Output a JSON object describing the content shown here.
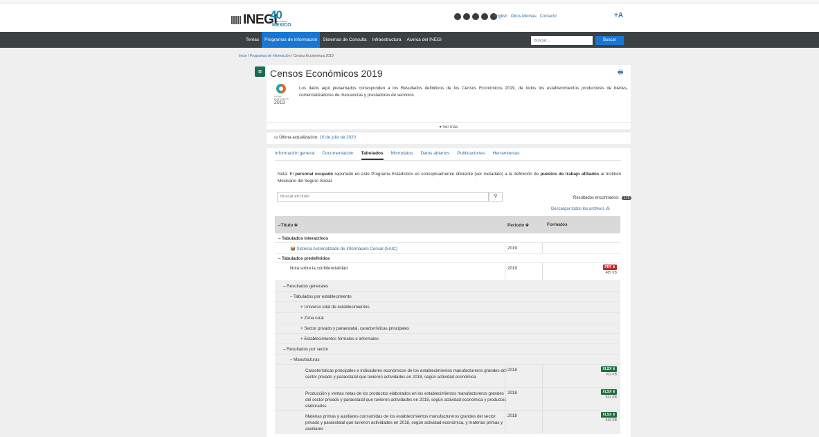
{
  "header": {
    "logo_text": "INEGI",
    "anniv": {
      "num": "40",
      "sub": "AÑOS DE CONTAR",
      "country": "MÉXICO"
    },
    "links": [
      "English",
      "Otros idiomas",
      "Contacto"
    ],
    "font_size_label": "+A"
  },
  "nav": {
    "items": [
      "Temas",
      "Programas de información",
      "Sistemas de Consulta",
      "Infraestructura",
      "Acerca del INEGI"
    ],
    "active_index": 1,
    "search_placeholder": "Buscar...",
    "search_button": "Buscar"
  },
  "breadcrumb": {
    "home": "Inicio",
    "section": "Programas de información",
    "current": "Censos Económicos 2019"
  },
  "page": {
    "title": "Censos Económicos 2019",
    "logo_small": "Censos ECONÓMICOS",
    "logo_year": "2019",
    "intro": "Los datos aquí presentados corresponden a los Resultados definitivos de los Censos Económicos 2019, de todos los establecimientos productores de bienes, comercializadores de mercancías y prestadores de servicios.",
    "ver_mas": "▾ Ver más",
    "update_label": "Última actualización:",
    "update_date": "16 de julio de 2020"
  },
  "tabs": [
    "Información general",
    "Documentación",
    "Tabulados",
    "Microdatos",
    "Datos abiertos",
    "Publicaciones",
    "Herramientas"
  ],
  "note": {
    "t1": "Nota: El ",
    "b1": "personal ocupado",
    "t2": " reportado en este Programa Estadístico es conceptualmente diferente (ver metadato) a la definición de ",
    "b2": "puestos de trabajo afiliados",
    "t3": " al Instituto Mexicano del Seguro Social."
  },
  "search": {
    "placeholder": "Buscar en título",
    "results_label": "Resultados encontrados:",
    "results_count": "175",
    "download_all": "Descargar todos los archivos"
  },
  "table": {
    "headers": {
      "title": "–Título",
      "period": "Periodo",
      "formats": "Formatos"
    },
    "rows": [
      {
        "text": "– Tabulados interactivos",
        "bold": true
      },
      {
        "text": "Sistema Automatizado de Información Censal (SAIC)",
        "period": "2019",
        "link": true
      },
      {
        "text": "– Tabulados predefinidos",
        "bold": true
      },
      {
        "text": "Nota sobre la confidencialidad",
        "period": "2019",
        "format": "PDF ⬇",
        "size": "485 KB"
      },
      {
        "text": "– Resultados generales"
      },
      {
        "text": "– Tabulados por establecimiento"
      },
      {
        "text": "Universo total de establecimientos"
      },
      {
        "text": "Zona rural"
      },
      {
        "text": "Sector privado y paraestatal, características principales"
      },
      {
        "text": "Establecimientos formales e informales"
      },
      {
        "text": "– Resultados por sector"
      },
      {
        "text": "– Manufacturas"
      },
      {
        "text": "Características principales e indicadores económicos de los establecimientos manufactureros grandes del sector privado y paraestatal que tuvieron actividades en 2018, según actividad económica",
        "period": "2018",
        "format": "XLSX ⬇",
        "size": "702 KB"
      },
      {
        "text": "Producción y ventas netas de los productos elaborados en los establecimientos manufactureros grandes del sector privado y paraestatal que tuvieron actividades en 2018, según actividad económica y productos elaborados",
        "period": "2018",
        "format": "XLSX ⬇",
        "size": "912 KB"
      },
      {
        "text": "Materias primas y auxiliares consumidas de los establecimientos manufactureros grandes del sector privado y paraestatal que tuvieron actividades en 2018, según actividad económica, y materias primas y auxiliares",
        "period": "2018",
        "format": "XLSX ⬇",
        "size": "916 KB"
      }
    ]
  },
  "colors": {
    "nav_bg": "#3c4144",
    "accent": "#1976d2",
    "link": "#2d6ea8",
    "menu_green": "#1d6b52"
  }
}
